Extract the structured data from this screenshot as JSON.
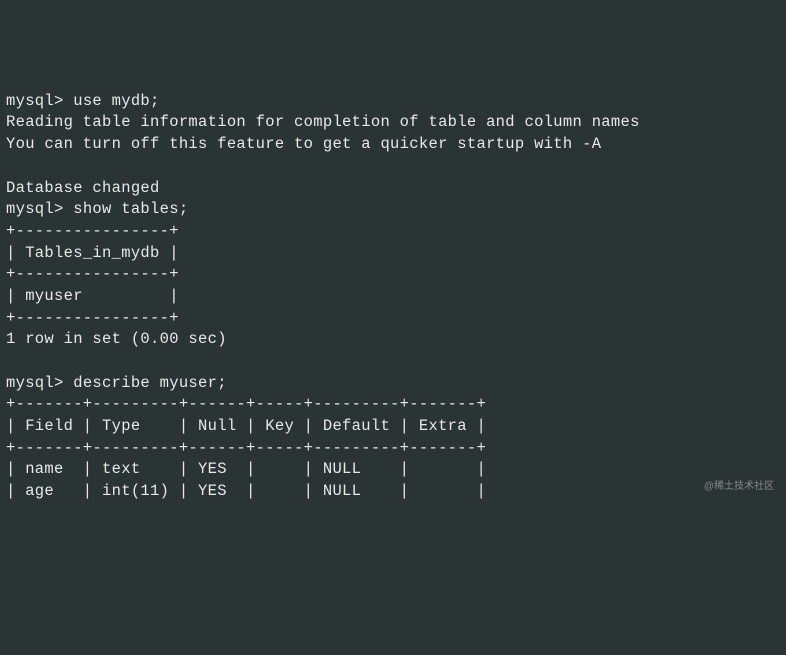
{
  "terminal": {
    "prompt": "mysql>",
    "commands": {
      "use_db": "use mydb;",
      "msg1": "Reading table information for completion of table and column names",
      "msg2": "You can turn off this feature to get a quicker startup with -A",
      "db_changed": "Database changed",
      "show_tables": "show tables;",
      "tables_border": "+----------------+",
      "tables_header": "| Tables_in_mydb |",
      "tables_row": "| myuser         |",
      "tables_summary": "1 row in set (0.00 sec)",
      "describe": "describe myuser;",
      "desc_border": "+-------+---------+------+-----+---------+-------+",
      "desc_header": "| Field | Type    | Null | Key | Default | Extra |",
      "desc_row1": "| name  | text    | YES  |     | NULL    |       |",
      "desc_row2": "| age   | int(11) | YES  |     | NULL    |       |"
    }
  },
  "watermark": "@稀土技术社区"
}
